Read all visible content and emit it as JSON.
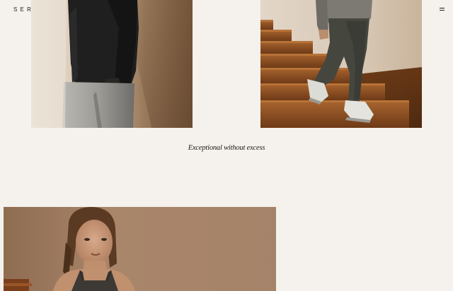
{
  "header": {
    "logo_text": "SERINO",
    "menu_icon": "hamburger-menu-icon"
  },
  "gallery": {
    "tagline": "Exceptional without excess",
    "photos": [
      {
        "subject": "man in dark sweater and grey trousers against beige wall"
      },
      {
        "subject": "man in grey trousers and sneakers walking down wooden stairs"
      },
      {
        "subject": "woman with slicked-back hair in dark tank top"
      }
    ]
  },
  "colors": {
    "background": "#f5f1ec",
    "text": "#1b1b1b",
    "wood": "#8a4f22"
  }
}
